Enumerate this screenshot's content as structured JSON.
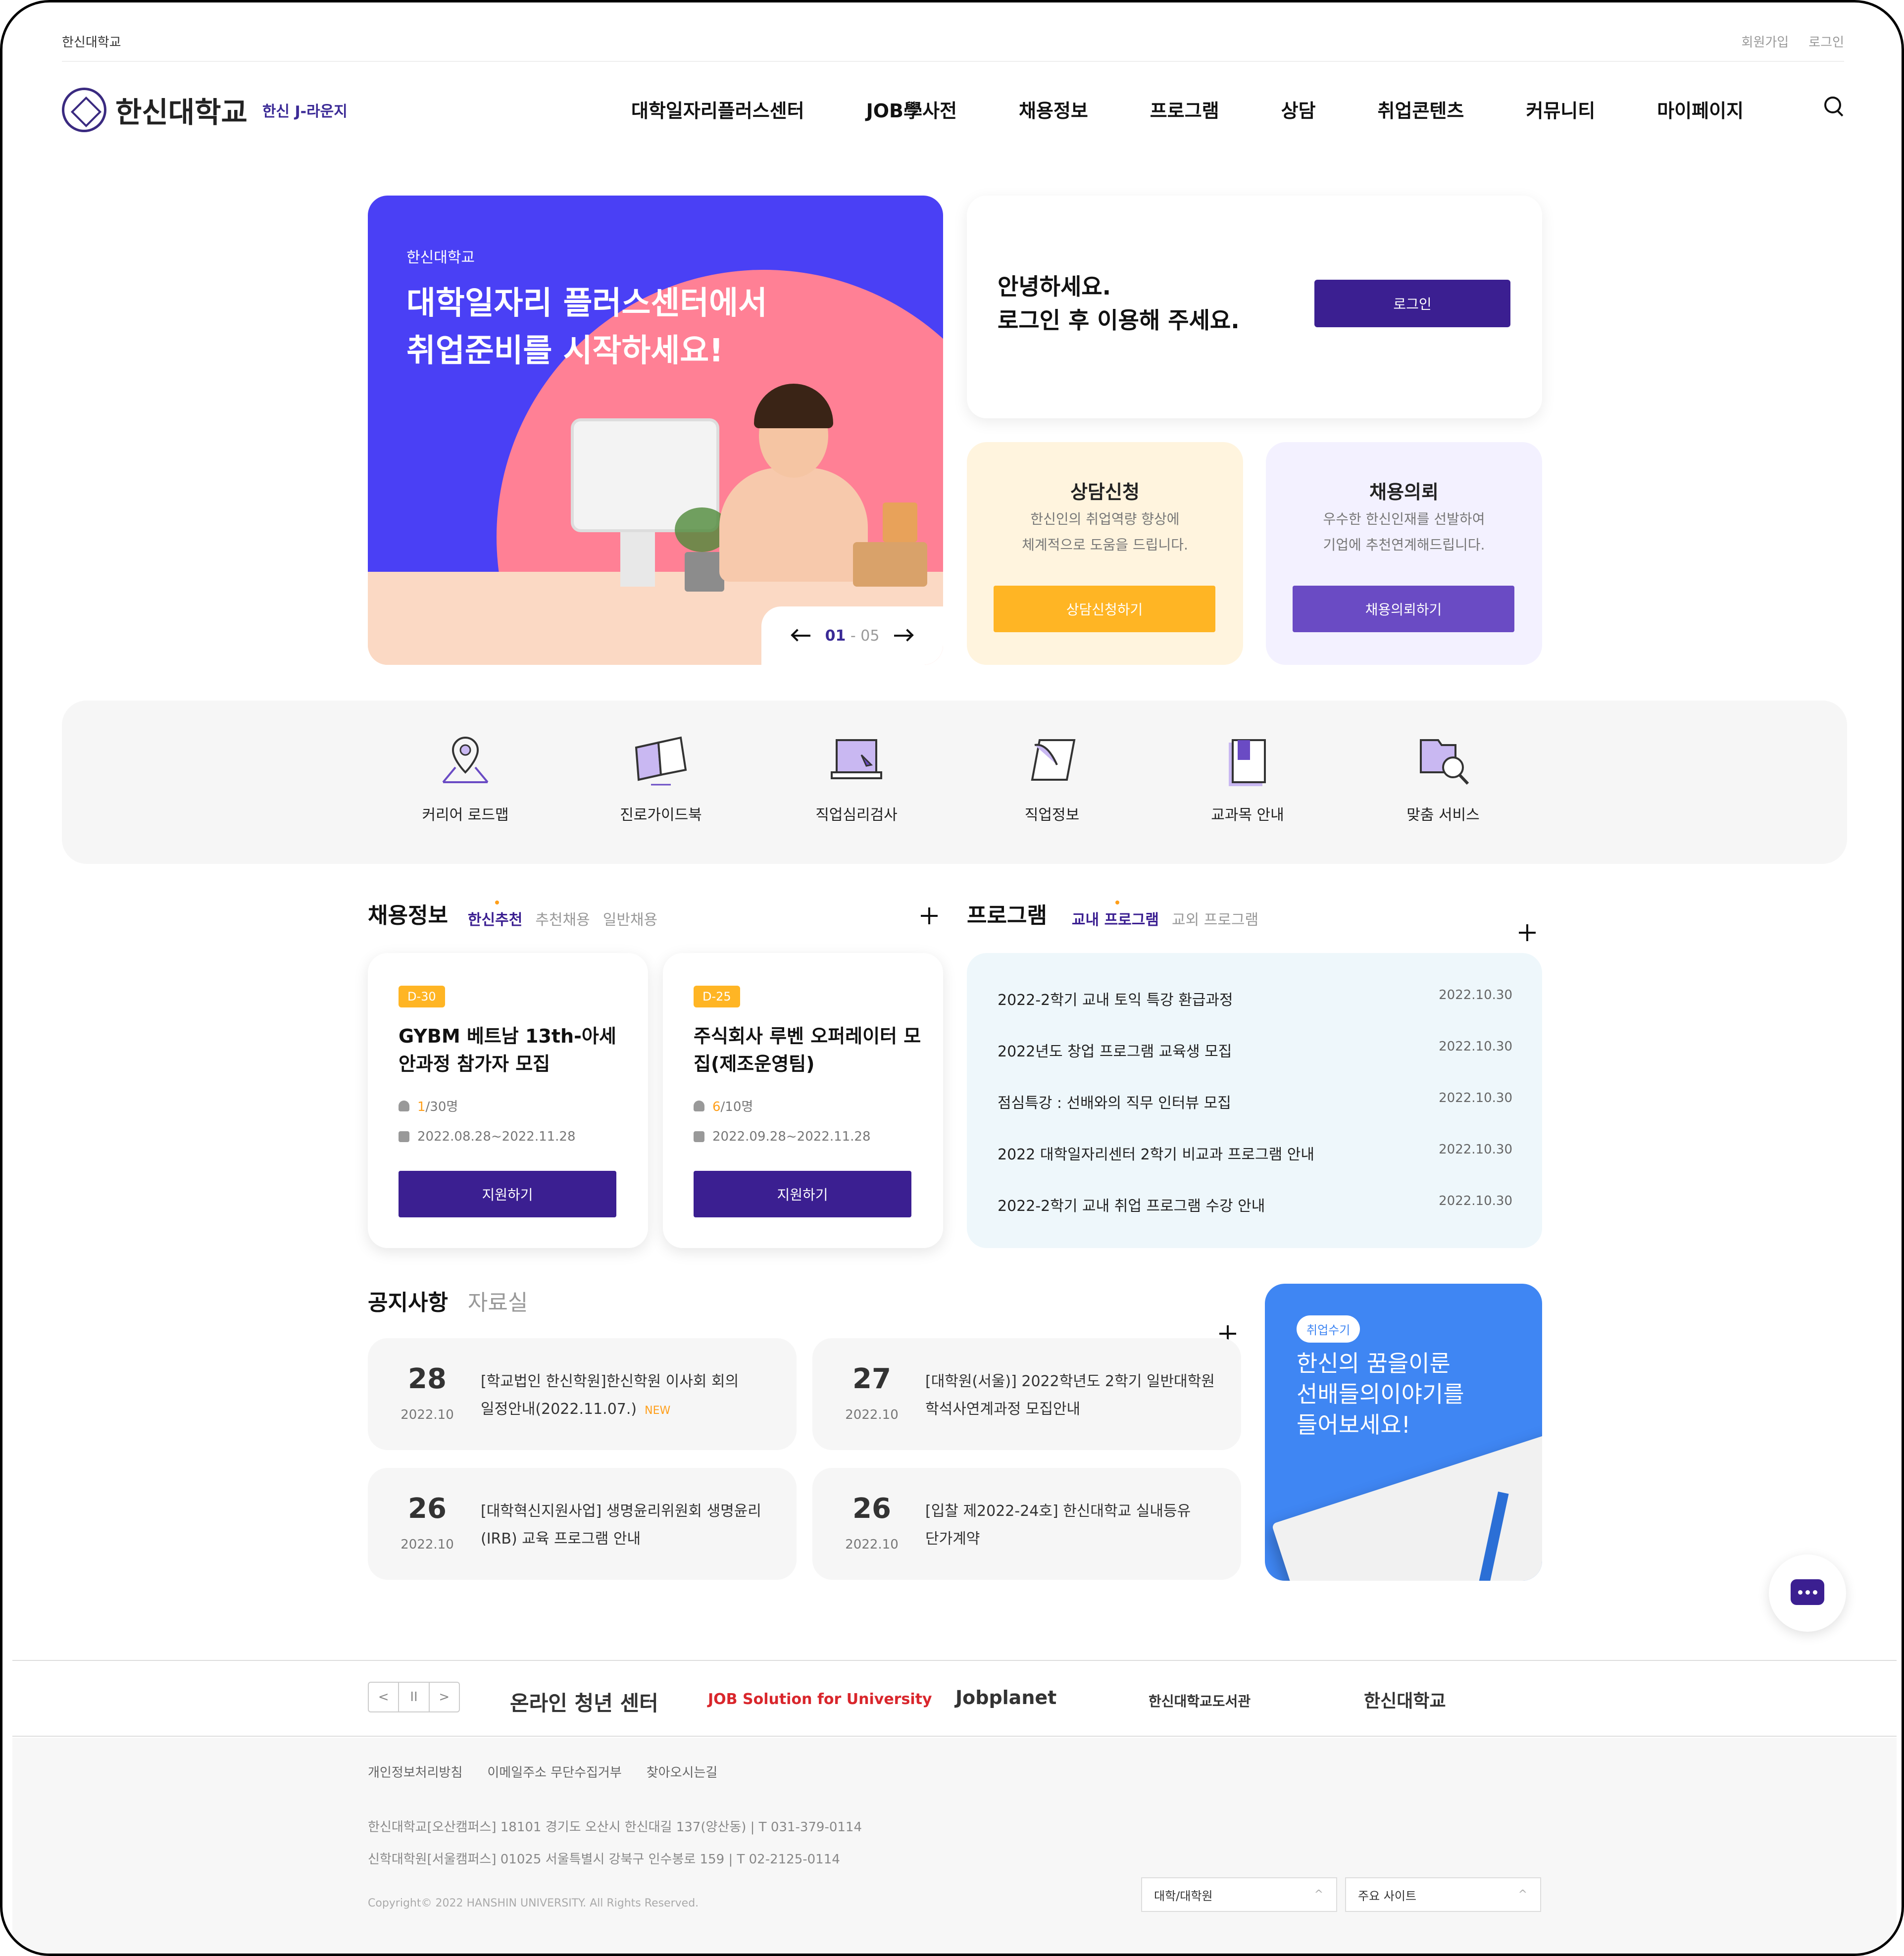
{
  "topbar": {
    "school": "한신대학교",
    "join": "회원가입",
    "login": "로그인"
  },
  "header": {
    "logo_text": "한신대학교",
    "site_name": "한신 J-라운지",
    "nav": [
      "대학일자리플러스센터",
      "JOB學사전",
      "채용정보",
      "프로그램",
      "상담",
      "취업콘텐츠",
      "커뮤니티",
      "마이페이지"
    ]
  },
  "hero": {
    "eyebrow": "한신대학교",
    "title_line1": "대학일자리 플러스센터에서",
    "title_line2": "취업준비를 시작하세요!",
    "page_current": "01",
    "page_sep": " - ",
    "page_total": "05"
  },
  "login_box": {
    "line1": "안녕하세요.",
    "line2": "로그인 후 이용해 주세요.",
    "button": "로그인"
  },
  "counsel_card": {
    "title": "상담신청",
    "desc1": "한신인의 취업역량 향상에",
    "desc2": "체계적으로 도움을 드립니다.",
    "button": "상담신청하기",
    "bg": "#fff4de",
    "btn_color": "#ffb524"
  },
  "recruit_card": {
    "title": "채용의뢰",
    "desc1": "우수한 한신인재를 선발하여",
    "desc2": "기업에 추천연계해드립니다.",
    "button": "채용의뢰하기",
    "bg": "#f3f1ff",
    "btn_color": "#6a4bc4"
  },
  "quick_menu": [
    {
      "label": "커리어 로드맵",
      "icon": "map-pin-icon"
    },
    {
      "label": "진로가이드북",
      "icon": "open-book-icon"
    },
    {
      "label": "직업심리검사",
      "icon": "laptop-test-icon"
    },
    {
      "label": "직업정보",
      "icon": "scroll-quill-icon"
    },
    {
      "label": "교과목 안내",
      "icon": "bookmark-book-icon"
    },
    {
      "label": "맞춤 서비스",
      "icon": "folder-search-icon"
    }
  ],
  "jobs": {
    "title": "채용정보",
    "tabs": [
      "한신추천",
      "추천채용",
      "일반채용"
    ],
    "cards": [
      {
        "dday": "D-30",
        "title": "GYBM 베트남 13th-아세안과정 참가자 모집",
        "applied": "1",
        "capacity": "/30명",
        "period": "2022.08.28~2022.11.28",
        "button": "지원하기"
      },
      {
        "dday": "D-25",
        "title": "주식회사 루벤 오퍼레이터 모집(제조운영팀)",
        "applied": "6",
        "capacity": "/10명",
        "period": "2022.09.28~2022.11.28",
        "button": "지원하기"
      }
    ]
  },
  "programs": {
    "title": "프로그램",
    "tabs": [
      "교내 프로그램",
      "교외 프로그램"
    ],
    "items": [
      {
        "title": "2022-2학기 교내 토익 특강 환급과정",
        "date": "2022.10.30"
      },
      {
        "title": "2022년도 창업 프로그램 교육생 모집",
        "date": "2022.10.30"
      },
      {
        "title": "점심특강 : 선배와의 직무 인터뷰 모집",
        "date": "2022.10.30"
      },
      {
        "title": "2022 대학일자리센터 2학기 비교과 프로그램 안내",
        "date": "2022.10.30"
      },
      {
        "title": "2022-2학기 교내 취업 프로그램 수강 안내",
        "date": "2022.10.30"
      }
    ]
  },
  "notices": {
    "title": "공지사항",
    "tab2": "자료실",
    "items": [
      {
        "day": "28",
        "ym": "2022.10",
        "line1": "[학교법인 한신학원]한신학원 이사회 회의",
        "line2": "일정안내(2022.11.07.)",
        "new": "NEW"
      },
      {
        "day": "27",
        "ym": "2022.10",
        "line1": "[대학원(서울)] 2022학년도 2학기 일반대학원",
        "line2": "학석사연계과정 모집안내",
        "new": ""
      },
      {
        "day": "26",
        "ym": "2022.10",
        "line1": "[대학혁신지원사업] 생명윤리위원회 생명윤리",
        "line2": "(IRB) 교육 프로그램 안내",
        "new": ""
      },
      {
        "day": "26",
        "ym": "2022.10",
        "line1": "[입찰 제2022-24호] 한신대학교 실내등유",
        "line2": "단가계약",
        "new": ""
      }
    ]
  },
  "story": {
    "tag": "취업수기",
    "line1": "한신의 꿈을이룬",
    "line2": "선배들의이야기를",
    "line3": "들어보세요!"
  },
  "banners": {
    "prev": "<",
    "pause": "II",
    "next": ">",
    "items": [
      "온라인 청년 센터",
      "JOB Solution for University",
      "Jobplanet",
      "한신대학교도서관",
      "한신대학교"
    ]
  },
  "footer": {
    "links": [
      "개인정보처리방침",
      "이메일주소 무단수집거부",
      "찾아오시는길"
    ],
    "addr1": "한신대학교[오산캠퍼스]  18101 경기도 오산시 한신대길 137(양산동)  |  T 031-379-0114",
    "addr2": "신학대학원[서울캠퍼스]  01025 서울특별시 강북구 인수봉로 159  |  T 02-2125-0114",
    "copyright": "Copyright© 2022 HANSHIN UNIVERSITY. All Rights Reserved.",
    "select1": "대학/대학원",
    "select2": "주요 사이트"
  },
  "colors": {
    "primary": "#3b1f91",
    "accent": "#ffb524",
    "hero_blue": "#4a40f5",
    "hero_pink": "#ff8095"
  }
}
